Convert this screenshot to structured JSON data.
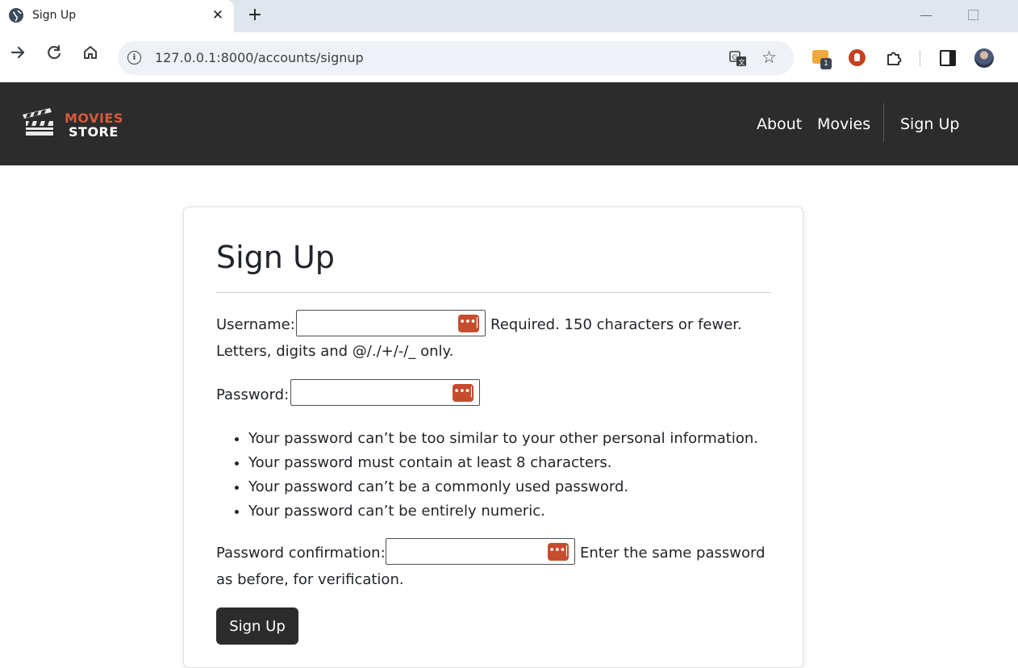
{
  "browser": {
    "tab_title": "Sign Up",
    "tab_close": "✕",
    "new_tab": "+",
    "url": "127.0.0.1:8000/accounts/signup",
    "extension_badge": "1",
    "icons": [
      "globe-icon",
      "back-icon",
      "reload-icon",
      "home-icon",
      "info-icon",
      "translate-icon",
      "star-icon",
      "extension-icon",
      "ublock-icon",
      "puzzle-icon",
      "side-panel-icon",
      "profile-avatar"
    ]
  },
  "navbar": {
    "logo_top": "MOVIES",
    "logo_bottom": "STORE",
    "links": [
      "About",
      "Movies",
      "Sign Up"
    ],
    "colors": {
      "background": "#2c2c2c",
      "logo_accent": "#d9593a"
    }
  },
  "form": {
    "title": "Sign Up",
    "username_label": "Username:",
    "username_help_1": "Required. 150 characters or fewer.",
    "username_help_2": "Letters, digits and @/./+/-/_ only.",
    "password_label": "Password:",
    "password_rules": [
      "Your password can’t be too similar to your other personal information.",
      "Your password must contain at least 8 characters.",
      "Your password can’t be a commonly used password.",
      "Your password can’t be entirely numeric."
    ],
    "confirm_label": "Password confirmation:",
    "confirm_help_1": "Enter the same password",
    "confirm_help_2": "as before, for verification.",
    "submit_label": "Sign Up",
    "password_manager_icon": "•••|",
    "colors": {
      "button": "#2c2c2c",
      "password_manager": "#c54d2d"
    }
  }
}
